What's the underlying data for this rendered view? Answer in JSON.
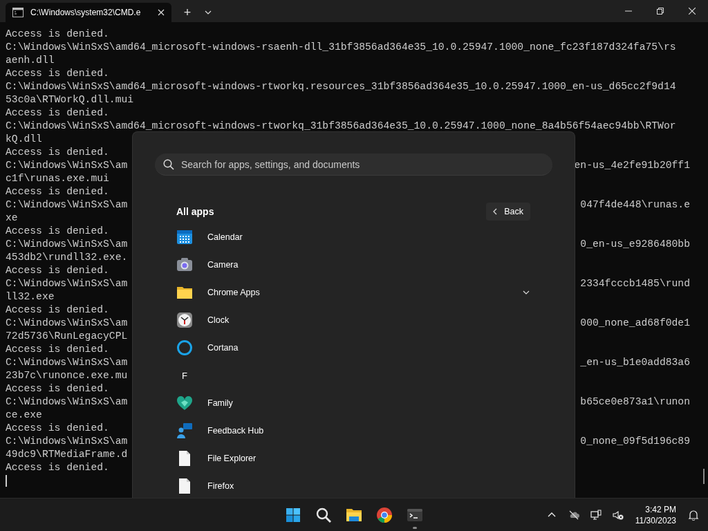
{
  "tab_bar": {
    "tabs": [
      {
        "title": "C:\\Windows\\system32\\CMD.e",
        "selected": true
      }
    ],
    "new_tab": "+"
  },
  "terminal": {
    "lines": [
      {
        "left": "Access is denied."
      },
      {
        "left": "C:\\Windows\\WinSxS\\amd64_microsoft-windows-rsaenh-dll_31bf3856ad364e35_10.0.25947.1000_none_fc23f187d324fa75\\rs"
      },
      {
        "left": "aenh.dll"
      },
      {
        "left": "Access is denied."
      },
      {
        "left": "C:\\Windows\\WinSxS\\amd64_microsoft-windows-rtworkq.resources_31bf3856ad364e35_10.0.25947.1000_en-us_d65cc2f9d14"
      },
      {
        "left": "53c0a\\RTWorkQ.dll.mui"
      },
      {
        "left": "Access is denied."
      },
      {
        "left": "C:\\Windows\\WinSxS\\amd64_microsoft-windows-rtworkq_31bf3856ad364e35_10.0.25947.1000_none_8a4b56f54aec94bb\\RTWor"
      },
      {
        "left": "kQ.dll"
      },
      {
        "left": "Access is denied."
      },
      {
        "left": "C:\\Windows\\WinSxS\\am",
        "right": "en-us_4e2fe91b20ff1"
      },
      {
        "left": "c1f\\runas.exe.mui"
      },
      {
        "left": "Access is denied."
      },
      {
        "left": "C:\\Windows\\WinSxS\\am",
        "right": "047f4de448\\runas.e"
      },
      {
        "left": "xe"
      },
      {
        "left": "Access is denied."
      },
      {
        "left": "C:\\Windows\\WinSxS\\am",
        "right": "0_en-us_e9286480bb"
      },
      {
        "left": "453db2\\rundll32.exe."
      },
      {
        "left": "Access is denied."
      },
      {
        "left": "C:\\Windows\\WinSxS\\am",
        "right": "2334fcccb1485\\rund"
      },
      {
        "left": "ll32.exe"
      },
      {
        "left": "Access is denied."
      },
      {
        "left": "C:\\Windows\\WinSxS\\am",
        "right": "000_none_ad68f0de1"
      },
      {
        "left": "72d5736\\RunLegacyCPL"
      },
      {
        "left": "Access is denied."
      },
      {
        "left": "C:\\Windows\\WinSxS\\am",
        "right": "_en-us_b1e0add83a6"
      },
      {
        "left": "23b7c\\runonce.exe.mu"
      },
      {
        "left": "Access is denied."
      },
      {
        "left": "C:\\Windows\\WinSxS\\am",
        "right": "b65ce0e873a1\\runon"
      },
      {
        "left": "ce.exe"
      },
      {
        "left": "Access is denied."
      },
      {
        "left": "C:\\Windows\\WinSxS\\am",
        "right": "0_none_09f5d196c89"
      },
      {
        "left": "49dc9\\RTMediaFrame.d"
      },
      {
        "left": "Access is denied."
      }
    ]
  },
  "start_menu": {
    "search": {
      "placeholder": "Search for apps, settings, and documents"
    },
    "heading": "All apps",
    "back_button": "Back",
    "apps": [
      {
        "kind": "app",
        "name": "Calendar"
      },
      {
        "kind": "app",
        "name": "Camera"
      },
      {
        "kind": "folder",
        "name": "Chrome Apps",
        "expanded": false
      },
      {
        "kind": "app",
        "name": "Clock"
      },
      {
        "kind": "app",
        "name": "Cortana"
      },
      {
        "kind": "letter",
        "name": "F"
      },
      {
        "kind": "app",
        "name": "Family"
      },
      {
        "kind": "app",
        "name": "Feedback Hub"
      },
      {
        "kind": "app",
        "name": "File Explorer"
      },
      {
        "kind": "app",
        "name": "Firefox"
      }
    ]
  },
  "taskbar": {
    "apps": [
      {
        "running": false
      },
      {
        "running": false
      },
      {
        "running": false
      },
      {
        "running": false
      },
      {
        "running": true
      }
    ],
    "clock": {
      "time": "3:42 PM",
      "date": "11/30/2023"
    }
  }
}
